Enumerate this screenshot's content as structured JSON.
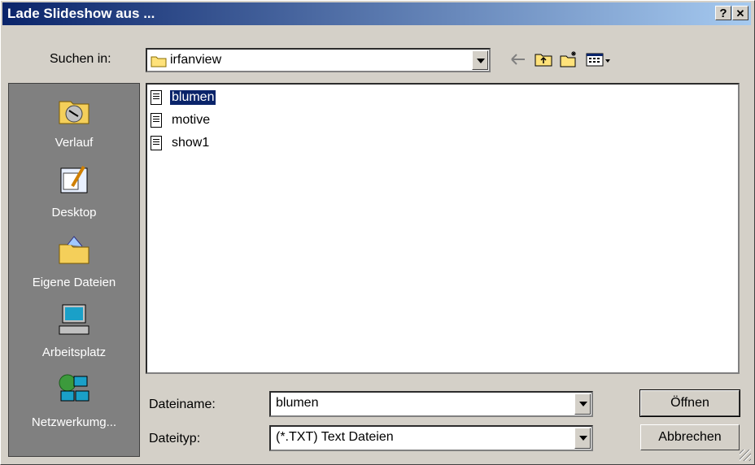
{
  "window": {
    "title": "Lade Slideshow aus ...",
    "help_label": "?",
    "close_label": "✕"
  },
  "lookin": {
    "label": "Suchen in:",
    "folder": "irfanview"
  },
  "toolbar": {
    "icons": [
      "back-arrow-icon",
      "up-folder-icon",
      "new-folder-icon",
      "view-menu-icon"
    ]
  },
  "places": [
    {
      "label": "Verlauf",
      "icon": "history-icon"
    },
    {
      "label": "Desktop",
      "icon": "desktop-icon"
    },
    {
      "label": "Eigene Dateien",
      "icon": "my-documents-icon"
    },
    {
      "label": "Arbeitsplatz",
      "icon": "my-computer-icon"
    },
    {
      "label": "Netzwerkumg...",
      "icon": "network-icon"
    }
  ],
  "files": [
    {
      "name": "blumen",
      "selected": true
    },
    {
      "name": "motive",
      "selected": false
    },
    {
      "name": "show1",
      "selected": false
    }
  ],
  "filename": {
    "label": "Dateiname:",
    "value": "blumen"
  },
  "filetype": {
    "label": "Dateityp:",
    "value": "(*.TXT) Text Dateien"
  },
  "buttons": {
    "open": "Öffnen",
    "cancel": "Abbrechen"
  }
}
